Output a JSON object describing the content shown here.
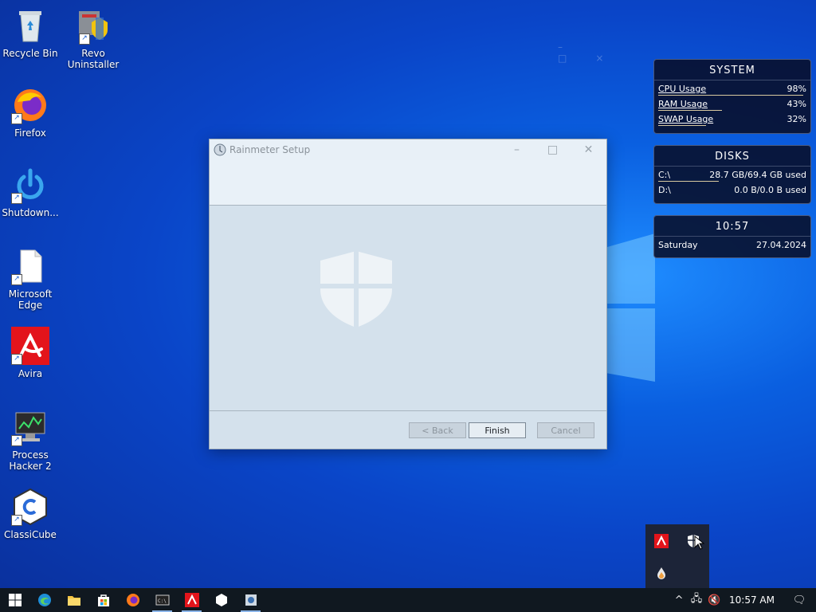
{
  "desktop": {
    "icons": [
      {
        "label": "Recycle Bin"
      },
      {
        "label": "Revo\nUninstaller"
      },
      {
        "label": "Firefox"
      },
      {
        "label": "Shutdown..."
      },
      {
        "label": "Microsoft\nEdge"
      },
      {
        "label": "Avira"
      },
      {
        "label": "Process\nHacker 2"
      },
      {
        "label": "ClassiCube"
      }
    ]
  },
  "widgets": {
    "system": {
      "title": "SYSTEM",
      "rows": [
        {
          "label": "CPU Usage",
          "value": "98%",
          "fraction": 0.98
        },
        {
          "label": "RAM Usage",
          "value": "43%",
          "fraction": 0.43
        },
        {
          "label": "SWAP Usage",
          "value": "32%",
          "fraction": 0.32
        }
      ]
    },
    "disks": {
      "title": "DISKS",
      "rows": [
        {
          "label": "C:\\",
          "value": "28.7 GB/69.4 GB used",
          "fraction": 0.41
        },
        {
          "label": "D:\\",
          "value": "0.0 B/0.0 B used",
          "fraction": 0.0
        }
      ]
    },
    "clock": {
      "time": "10:57",
      "day": "Saturday",
      "date": "27.04.2024"
    }
  },
  "dialog": {
    "title": "Rainmeter Setup",
    "back_label": "< Back",
    "finish_label": "Finish",
    "cancel_label": "Cancel"
  },
  "taskbar": {
    "time": "10:57 AM"
  },
  "colors": {
    "accent": "#0a5fe0",
    "avira_red": "#e3141b",
    "taskbar": "#101820"
  }
}
